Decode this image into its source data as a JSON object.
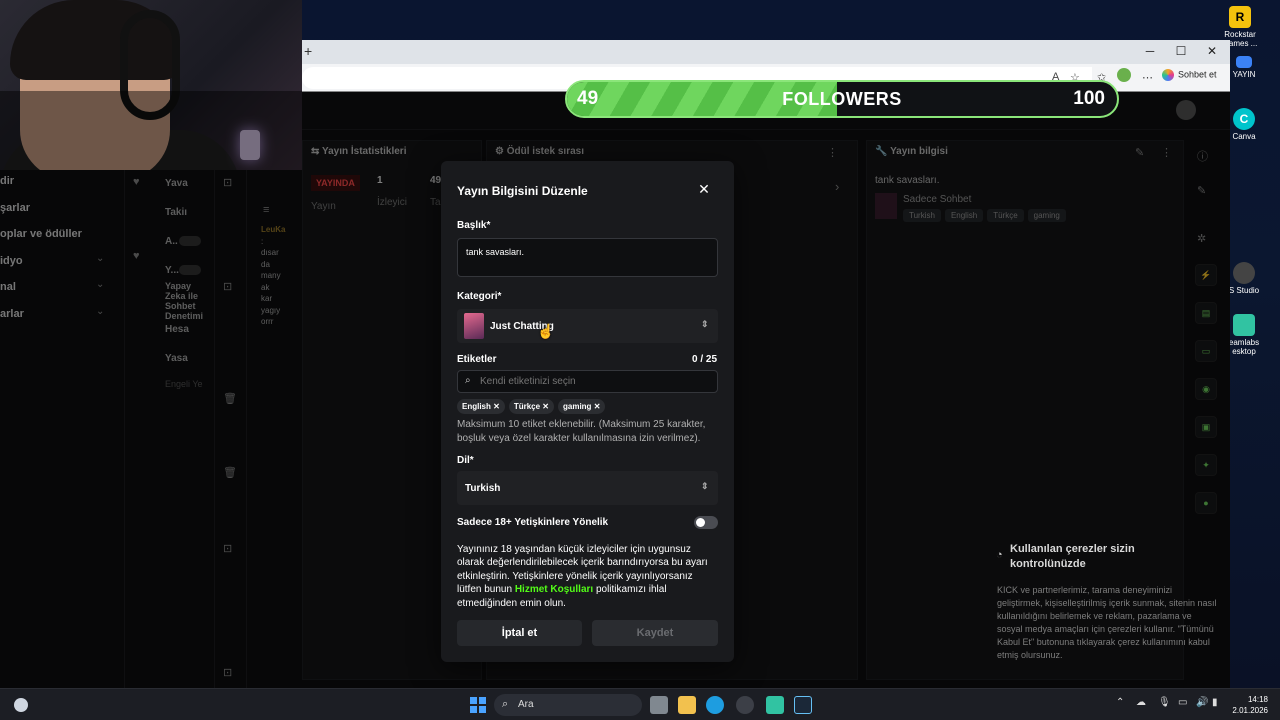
{
  "desktop": {
    "icons": [
      {
        "label": "Rockstar Games ...",
        "icon": "rockstar-icon",
        "color": "#f4c20d"
      },
      {
        "label": "YAYIN",
        "icon": "folder-icon",
        "color": "#3b82f6"
      },
      {
        "label": "Canva",
        "icon": "canva-icon",
        "color": "#00c4cc"
      },
      {
        "label": "S Studio",
        "icon": "obs-icon",
        "color": "#444444"
      },
      {
        "label": "eamlabs esktop",
        "icon": "streamlabs-icon",
        "color": "#31c3a2"
      }
    ]
  },
  "browser": {
    "new_tab": "+",
    "controls": {
      "minimize": "─",
      "maximize": "☐",
      "close": "✕"
    },
    "chat_button": "Sohbet et"
  },
  "followers_goal": {
    "current": "49",
    "label": "FOLLOWERS",
    "goal": "100",
    "progress": 0.49,
    "fill_color": "#6fd65e"
  },
  "sidebar": {
    "items": [
      {
        "label": "dir",
        "chevron": ""
      },
      {
        "label": "şarlar",
        "chevron": ""
      },
      {
        "label": "oplar ve ödüller",
        "chevron": ""
      },
      {
        "label": "idyo",
        "chevron": "⌄"
      },
      {
        "label": "nal",
        "chevron": "⌄"
      },
      {
        "label": "arlar",
        "chevron": "⌄"
      }
    ]
  },
  "dashboard": {
    "col2": [
      "Yava",
      "Takiı",
      "A..",
      "Y...",
      "Yapay Zeka ile Sohbet Denetimi",
      "Hesa",
      "Yasa",
      "Engeli Ye"
    ],
    "chat_preview": [
      "LeuKa",
      ":",
      "dısar",
      "da",
      "many",
      "ak",
      "kar",
      "yagıy",
      "orrr"
    ],
    "stats_panel": {
      "title": "Yayın İstatistikleri",
      "live_badge": "YAYINDA",
      "live_sub": "Yayın",
      "viewers": "1",
      "viewers_sub": "İzleyici",
      "other": "49",
      "other_sub": "Ta"
    },
    "reward_panel": {
      "title": "Ödül istek sırası"
    },
    "info_panel": {
      "title": "Yayın bilgisi",
      "stream_title": "tank savasları.",
      "category": "Sadece Sohbet",
      "tags": [
        "Turkish",
        "English",
        "Türkçe",
        "gaming"
      ]
    }
  },
  "modal": {
    "title": "Yayın Bilgisini Düzenle",
    "title_label": "Başlık*",
    "title_value": "tank savasları.",
    "category_label": "Kategori*",
    "category_value": "Just Chatting",
    "tags_label": "Etiketler",
    "tags_count": "0 / 25",
    "tags_placeholder": "Kendi etiketinizi seçin",
    "chips": [
      "English",
      "Türkçe",
      "gaming"
    ],
    "tags_help": "Maksimum 10 etiket eklenebilir. (Maksimum 25 karakter, boşluk veya özel karakter kullanılmasına izin verilmez).",
    "language_label": "Dil*",
    "language_value": "Turkish",
    "adult_label": "Sadece 18+ Yetişkinlere Yönelik",
    "adult_help_1": "Yayınınız 18 yaşından küçük izleyiciler için uygunsuz olarak değerlendirilebilecek içerik barındırıyorsa bu ayarı etkinleştirin. Yetişkinlere yönelik içerik yayınlıyorsanız lütfen bunun ",
    "adult_help_link": "Hizmet Koşulları",
    "adult_help_2": " politikamızı ihlal etmediğinden emin olun.",
    "cancel_label": "İptal et",
    "save_label": "Kaydet",
    "accent": "#53fc18"
  },
  "cookie": {
    "title": "Kullanılan çerezler sizin kontrolünüzde",
    "body": "KICK ve partnerlerimiz, tarama deneyiminizi geliştirmek, kişiselleştirilmiş içerik sunmak, sitenin nasıl kullanıldığını belirlemek ve reklam, pazarlama ve sosyal medya amaçları için çerezleri kullanır. \"Tümünü Kabul Et\" butonuna tıklayarak çerez kullanımını kabul etmiş olursunuz."
  },
  "taskbar": {
    "search_label": "Ara",
    "time": "14:18",
    "date": "2.01.2026"
  }
}
